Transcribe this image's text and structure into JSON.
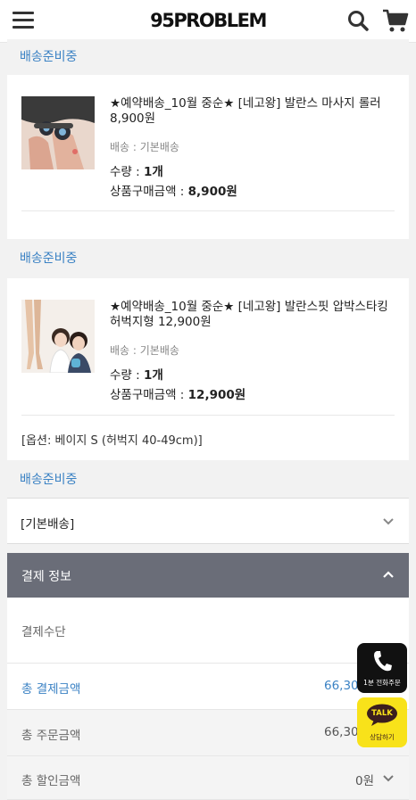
{
  "header": {
    "logo": "95PROBLEM"
  },
  "orders": [
    {
      "status": "배송준비중",
      "name": "★예약배송_10월 중순★ [네고왕] 발란스 마사지 롤러 8,900원",
      "shipping": "배송 : 기본배송",
      "qty_label": "수량 : ",
      "qty_value": "1개",
      "subtotal_label": "상품구매금액 : ",
      "subtotal_value": "8,900원"
    },
    {
      "status": "배송준비중",
      "name": "★예약배송_10월 중순★ [네고왕] 발란스핏 압박스타킹 허벅지형 12,900원",
      "shipping": "배송 : 기본배송",
      "qty_label": "수량 : ",
      "qty_value": "1개",
      "subtotal_label": "상품구매금액 : ",
      "subtotal_value": "12,900원",
      "option": "[옵션: 베이지 S (허벅지 40-49cm)]"
    }
  ],
  "shipping_group": {
    "status": "배송준비중",
    "type": "[기본배송]"
  },
  "payment": {
    "header": "결제 정보",
    "method_label": "결제수단",
    "total_pay_label": "총 결제금액",
    "total_pay_value": "66,30",
    "total_order_label": "총 주문금액",
    "total_order_value": "66,30",
    "total_discount_label": "총 할인금액",
    "total_discount_value": "0원"
  },
  "floating": {
    "phone_caption": "1분 전화주문",
    "talk_label": "TALK",
    "talk_caption": "상담하기"
  },
  "colors": {
    "accent_blue": "#3b82c4",
    "pay_header_bg": "#6a6d78",
    "kakao_yellow": "#f8e21a"
  }
}
